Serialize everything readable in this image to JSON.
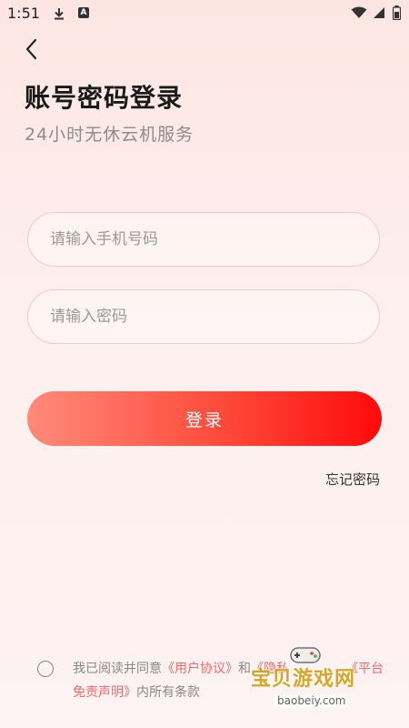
{
  "status_bar": {
    "time": "1:51",
    "icons": [
      "download-icon",
      "app-a-icon",
      "wifi-icon",
      "signal-icon",
      "battery-icon"
    ]
  },
  "nav": {
    "back_icon": "chevron-left-icon"
  },
  "header": {
    "title": "账号密码登录",
    "subtitle": "24小时无休云机服务"
  },
  "form": {
    "phone_placeholder": "请输入手机号码",
    "phone_value": "",
    "password_placeholder": "请输入密码",
    "password_value": "",
    "login_label": "登录",
    "forgot_label": "忘记密码"
  },
  "agreement": {
    "checked": false,
    "prefix": "我已阅读并同意",
    "user_agreement": "《用户协议》",
    "and": "和",
    "privacy": "《隐私",
    "platform": "《平台",
    "disclaimer": "免责声明》",
    "suffix": "内所有条款"
  },
  "watermark": {
    "title": "宝贝游戏网",
    "url": "baobeiy.com"
  },
  "colors": {
    "accent": "#ff1a1a",
    "accent_light": "#ff8a7a",
    "link": "#f06b6b",
    "field_border": "#f5c9c9"
  }
}
